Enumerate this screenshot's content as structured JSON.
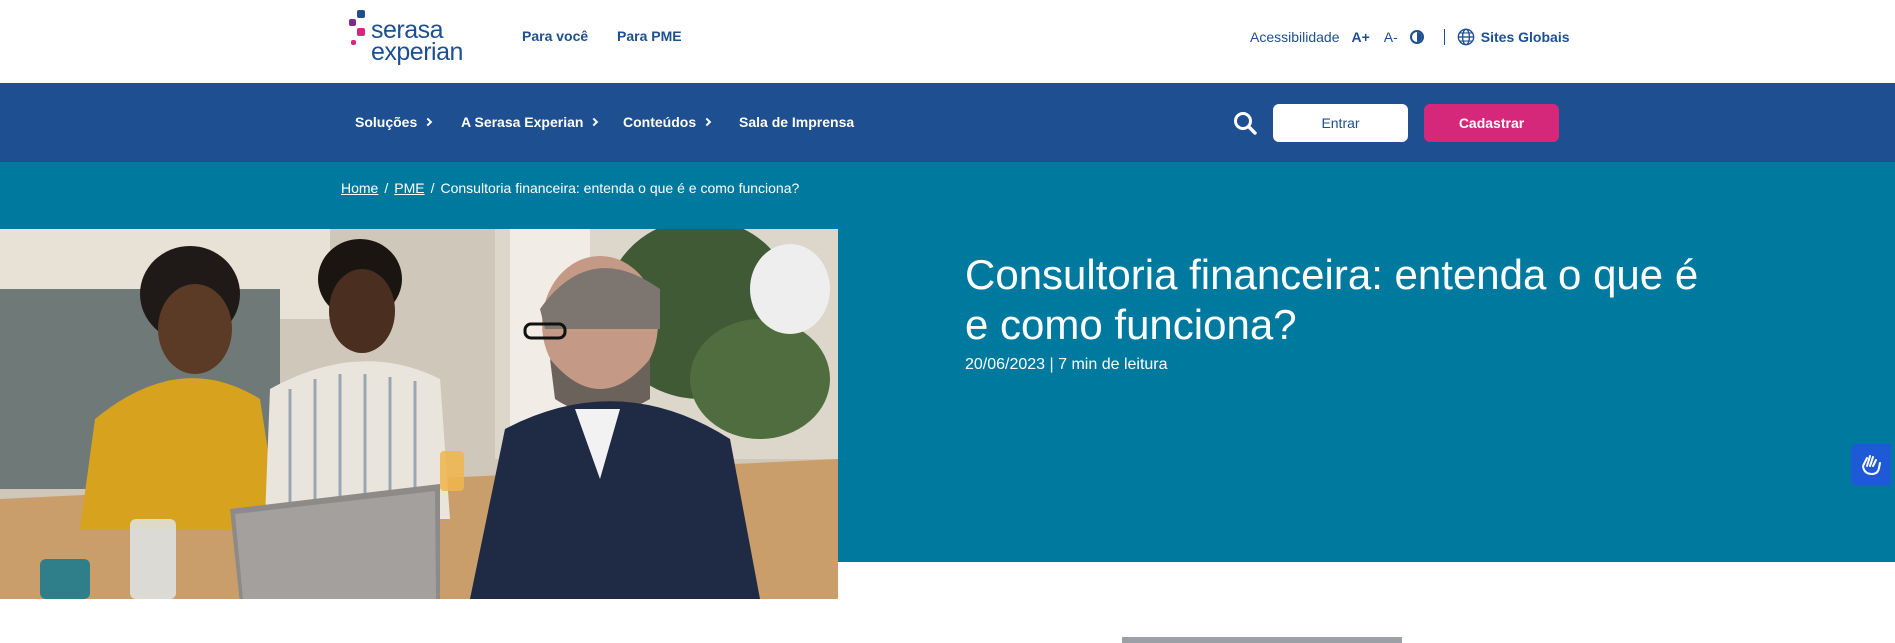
{
  "brand": {
    "name_line1": "serasa",
    "name_line2": "experian",
    "colors": {
      "navy": "#1d4f91",
      "magenta": "#d6287a",
      "teal": "#00799e",
      "purple": "#7b2d8e"
    }
  },
  "topbar": {
    "nav": [
      "Para você",
      "Para PME"
    ],
    "accessibility_label": "Acessibilidade",
    "font_increase": "A+",
    "font_decrease": "A-",
    "contrast_icon": "contrast-icon",
    "globe_icon": "globe-icon",
    "sites_label": "Sites Globais"
  },
  "mainnav": {
    "items": [
      {
        "label": "Soluções",
        "has_chevron": true
      },
      {
        "label": "A Serasa Experian",
        "has_chevron": true
      },
      {
        "label": "Conteúdos",
        "has_chevron": true
      },
      {
        "label": "Sala de Imprensa",
        "has_chevron": false
      }
    ],
    "search_icon": "search-icon",
    "login_label": "Entrar",
    "signup_label": "Cadastrar"
  },
  "breadcrumb": {
    "items": [
      "Home",
      "PME"
    ],
    "separator": "/",
    "current": "Consultoria financeira: entenda o que é e como funciona?"
  },
  "article": {
    "title": "Consultoria financeira: entenda o que é e como funciona?",
    "meta": "20/06/2023 | 7 min de leitura"
  },
  "widgets": {
    "libras_icon": "sign-language-icon"
  }
}
